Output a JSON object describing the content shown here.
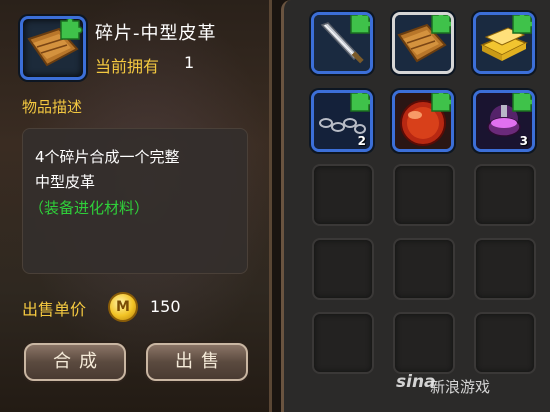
{
  "item": {
    "name": "碎片-中型皮革",
    "owned_label": "当前拥有",
    "owned_count": "1",
    "icon": "leather-fragment-icon"
  },
  "description": {
    "title": "物品描述",
    "line1": "4个碎片合成一个完整",
    "line2": "中型皮革",
    "tag": "（装备进化材料）"
  },
  "price": {
    "label": "出售单价",
    "coin_glyph": "M",
    "value": "150"
  },
  "buttons": {
    "combine": "合成",
    "sell": "出售"
  },
  "inventory": {
    "columns": 3,
    "rows": 5,
    "items": [
      {
        "icon": "dagger-fragment-icon",
        "qty": ""
      },
      {
        "icon": "leather-fragment-icon",
        "qty": "",
        "selected": true
      },
      {
        "icon": "gold-ingot-fragment-icon",
        "qty": ""
      },
      {
        "icon": "chain-fragment-icon",
        "qty": "2"
      },
      {
        "icon": "red-orb-fragment-icon",
        "qty": ""
      },
      {
        "icon": "purple-potion-fragment-icon",
        "qty": "3"
      }
    ]
  },
  "watermark": {
    "logo": "sina",
    "text": "新浪游戏"
  },
  "colors": {
    "gold_text": "#f3c840",
    "green_text": "#2fcf3a",
    "slot_border_blue": "#3c6fd8"
  }
}
